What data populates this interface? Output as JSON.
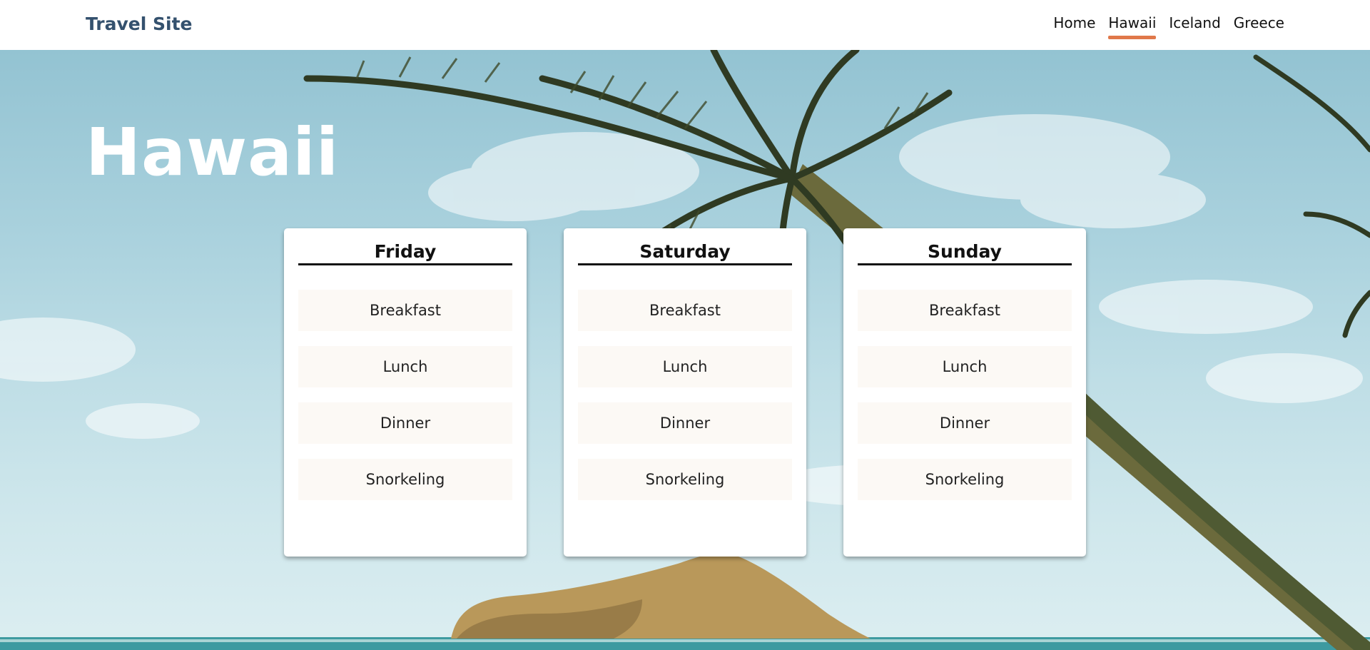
{
  "site": {
    "brand": "Travel Site"
  },
  "nav": {
    "items": [
      {
        "label": "Home",
        "active": false
      },
      {
        "label": "Hawaii",
        "active": true
      },
      {
        "label": "Iceland",
        "active": false
      },
      {
        "label": "Greece",
        "active": false
      }
    ]
  },
  "page": {
    "title": "Hawaii"
  },
  "days": [
    {
      "name": "Friday",
      "activities": [
        "Breakfast",
        "Lunch",
        "Dinner",
        "Snorkeling"
      ]
    },
    {
      "name": "Saturday",
      "activities": [
        "Breakfast",
        "Lunch",
        "Dinner",
        "Snorkeling"
      ]
    },
    {
      "name": "Sunday",
      "activities": [
        "Breakfast",
        "Lunch",
        "Dinner",
        "Snorkeling"
      ]
    }
  ],
  "colors": {
    "brand": "#34516e",
    "nav_active_underline": "#e0784a",
    "activity_background": "#fcf9f5",
    "card_background": "#ffffff"
  }
}
